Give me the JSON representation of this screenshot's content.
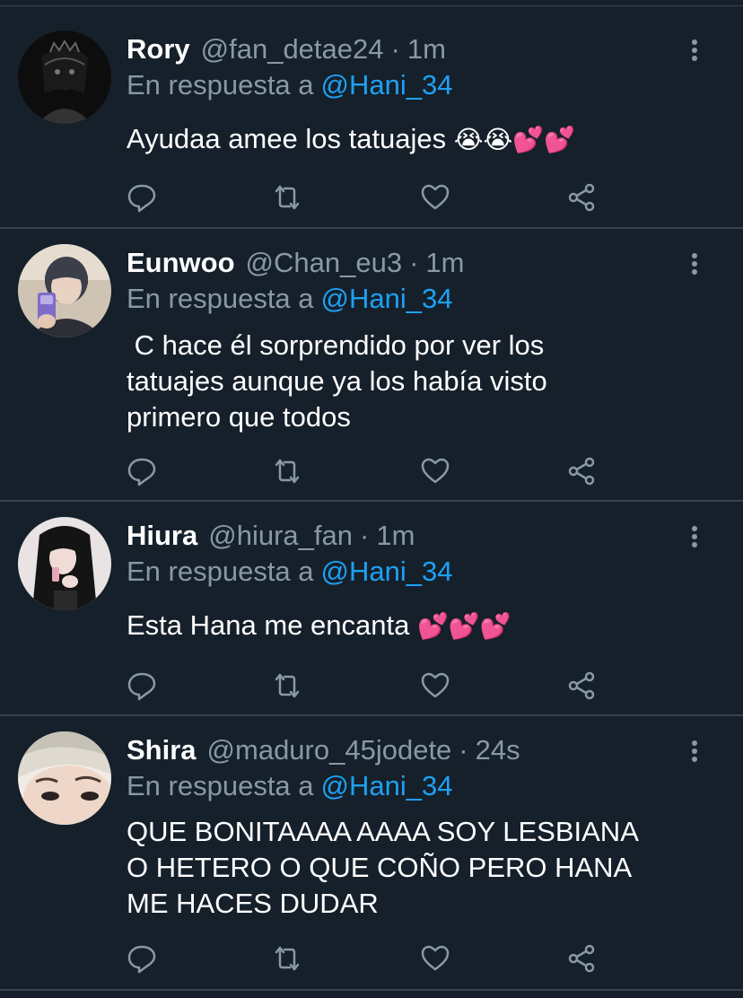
{
  "colors": {
    "background": "#15202b",
    "divider": "#38444d",
    "secondary_text": "#8899a6",
    "mention": "#1da1f2"
  },
  "tweets": [
    {
      "name": "Rory",
      "handle": "@fan_detae24",
      "separator": "·",
      "time": "1m",
      "reply_prefix": "En respuesta a",
      "reply_to": "@Hani_34",
      "text": "Ayudaa amee los tatuajes",
      "emoji": "😭😭💕💕"
    },
    {
      "name": "Eunwoo",
      "handle": "@Chan_eu3",
      "separator": "·",
      "time": "1m",
      "reply_prefix": "En respuesta a",
      "reply_to": "@Hani_34",
      "text": " C hace él sorprendido por ver los\ntatuajes aunque ya los había visto\nprimero que todos",
      "emoji": ""
    },
    {
      "name": "Hiura",
      "handle": "@hiura_fan",
      "separator": "·",
      "time": "1m",
      "reply_prefix": "En respuesta a",
      "reply_to": "@Hani_34",
      "text": "Esta Hana me encanta",
      "emoji": "💕💕💕"
    },
    {
      "name": "Shira",
      "handle": "@maduro_45jodete",
      "separator": "·",
      "time": "24s",
      "reply_prefix": "En respuesta a",
      "reply_to": "@Hani_34",
      "text": "QUE BONITAAAA AAAA SOY LESBIANA\nO HETERO O QUE COÑO PERO HANA\nME HACES DUDAR",
      "emoji": ""
    }
  ],
  "icons": {
    "reply": "reply-icon",
    "retweet": "retweet-icon",
    "like": "heart-icon",
    "share": "share-icon",
    "more": "more-vertical-icon"
  }
}
